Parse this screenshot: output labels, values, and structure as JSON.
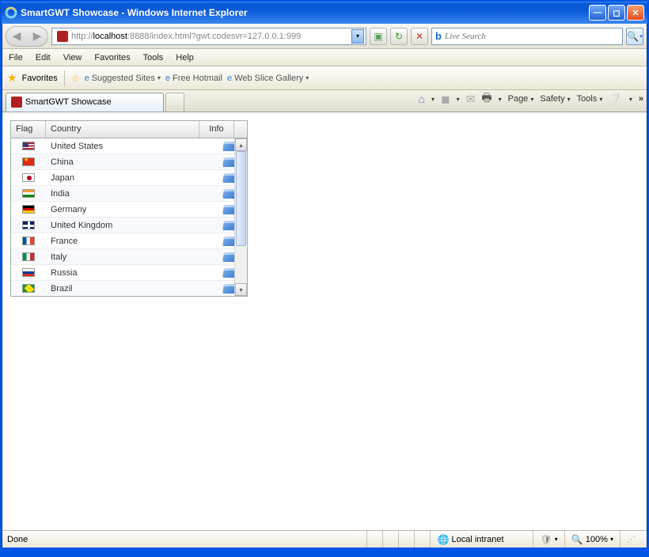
{
  "window": {
    "title": "SmartGWT Showcase - Windows Internet Explorer"
  },
  "address": {
    "url_pre": "http://",
    "url_host": "localhost",
    "url_rest": ":8888/index.html?gwt.codesvr=127.0.0.1:999"
  },
  "search": {
    "placeholder": "Live Search"
  },
  "menu": {
    "file": "File",
    "edit": "Edit",
    "view": "View",
    "favorites": "Favorites",
    "tools": "Tools",
    "help": "Help"
  },
  "favbar": {
    "favorites": "Favorites",
    "suggested": "Suggested Sites",
    "hotmail": "Free Hotmail",
    "webslice": "Web Slice Gallery"
  },
  "tab": {
    "title": "SmartGWT Showcase"
  },
  "cmd": {
    "page": "Page",
    "safety": "Safety",
    "tools": "Tools"
  },
  "grid": {
    "headers": {
      "flag": "Flag",
      "country": "Country",
      "info": "Info"
    },
    "rows": [
      {
        "country": "United States",
        "flag": "us"
      },
      {
        "country": "China",
        "flag": "cn"
      },
      {
        "country": "Japan",
        "flag": "jp"
      },
      {
        "country": "India",
        "flag": "in"
      },
      {
        "country": "Germany",
        "flag": "de"
      },
      {
        "country": "United Kingdom",
        "flag": "gb"
      },
      {
        "country": "France",
        "flag": "fr"
      },
      {
        "country": "Italy",
        "flag": "it"
      },
      {
        "country": "Russia",
        "flag": "ru"
      },
      {
        "country": "Brazil",
        "flag": "br"
      }
    ]
  },
  "status": {
    "done": "Done",
    "zone": "Local intranet",
    "zoom": "100%"
  }
}
